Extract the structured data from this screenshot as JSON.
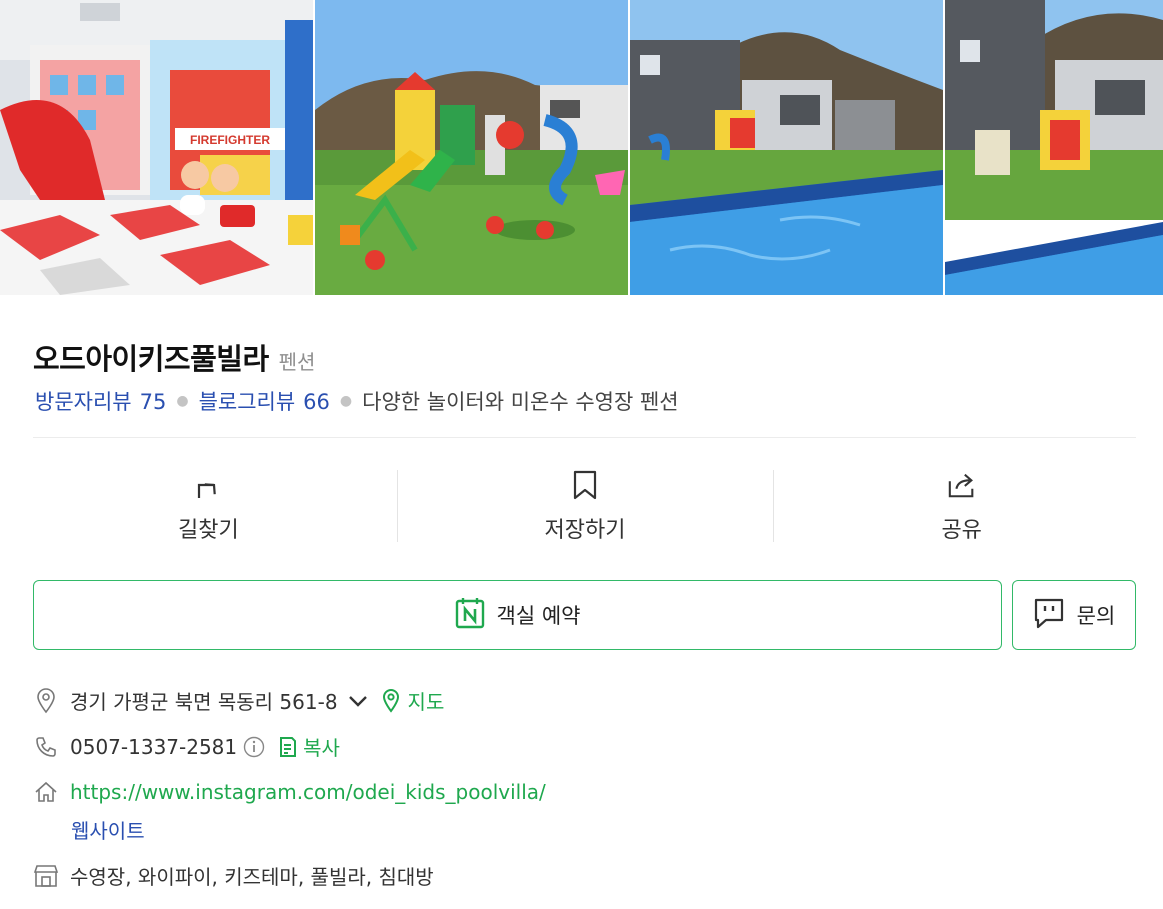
{
  "photos": [
    {
      "icon": "kids-room-photo",
      "sign_text": "FIREFIGHTER"
    },
    {
      "icon": "playground-photo"
    },
    {
      "icon": "pool-photo"
    },
    {
      "icon": "pool-building-photo"
    }
  ],
  "place": {
    "name": "오드아이키즈풀빌라",
    "category": "펜션",
    "visitor_review_label": "방문자리뷰",
    "visitor_review_count": "75",
    "blog_review_label": "블로그리뷰",
    "blog_review_count": "66",
    "description": "다양한 놀이터와 미온수 수영장 펜션"
  },
  "actions": {
    "directions": "길찾기",
    "save": "저장하기",
    "share": "공유"
  },
  "booking": {
    "reserve_label": "객실 예약",
    "inquiry_label": "문의"
  },
  "info": {
    "address": "경기 가평군 북면 목동리 561-8",
    "map_label": "지도",
    "phone": "0507-1337-2581",
    "copy_label": "복사",
    "website_url": "https://www.instagram.com/odei_kids_poolvilla/",
    "website_label": "웹사이트",
    "amenities": "수영장, 와이파이, 키즈테마, 풀빌라, 침대방"
  },
  "colors": {
    "accent_green": "#32b968",
    "link_blue": "#2a4fb0",
    "link_green": "#1fa84e"
  }
}
